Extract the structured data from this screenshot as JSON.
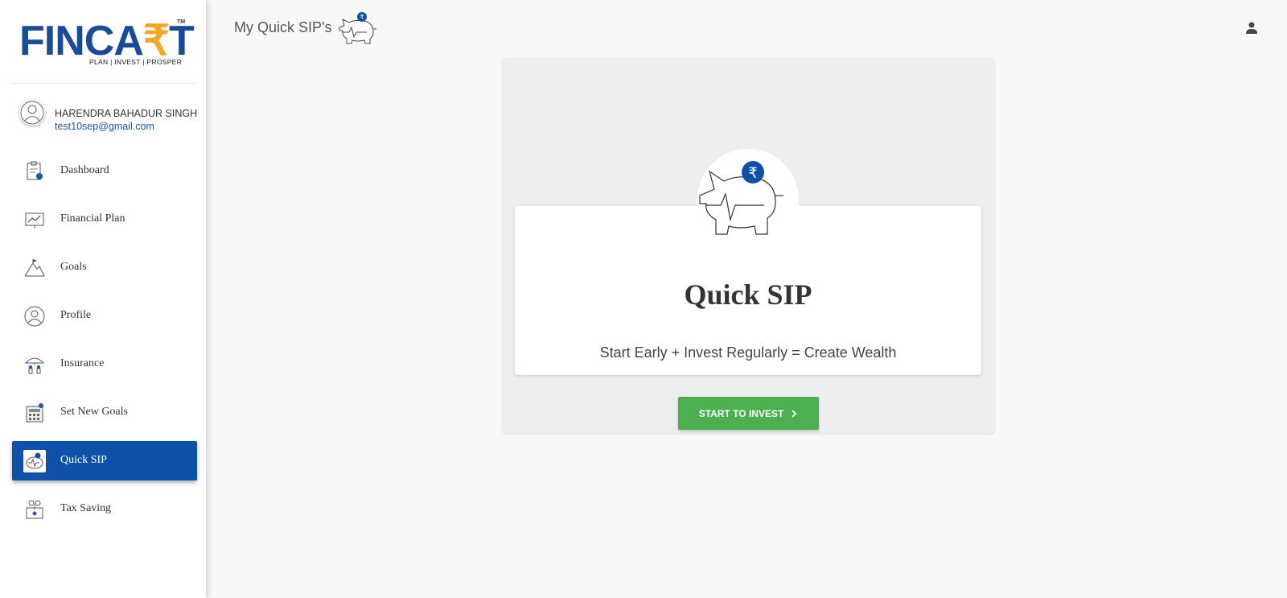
{
  "brand": {
    "logo_main_1": "FINCA",
    "logo_rupee": "₹",
    "logo_main_2": "T",
    "trademark": "TM",
    "tagline": "PLAN | INVEST | PROSPER",
    "primary_color": "#0d52a8",
    "accent_color": "#f5a623"
  },
  "user": {
    "name": "HARENDRA BAHADUR SINGH",
    "email": "test10sep@gmail.com",
    "avatar_icon": "user-circle-icon"
  },
  "nav": {
    "items": [
      {
        "label": "Dashboard",
        "icon": "clipboard-icon",
        "active": false
      },
      {
        "label": "Financial Plan",
        "icon": "chart-board-icon",
        "active": false
      },
      {
        "label": "Goals",
        "icon": "mountain-flag-icon",
        "active": false
      },
      {
        "label": "Profile",
        "icon": "profile-icon",
        "active": false
      },
      {
        "label": "Insurance",
        "icon": "umbrella-family-icon",
        "active": false
      },
      {
        "label": "Set New Goals",
        "icon": "calculator-icon",
        "active": false
      },
      {
        "label": "Quick SIP",
        "icon": "piggy-bank-icon",
        "active": true
      },
      {
        "label": "Tax Saving",
        "icon": "tax-saving-icon",
        "active": false
      }
    ]
  },
  "header": {
    "title": "My Quick SIP's",
    "icon": "piggy-bank-icon",
    "account_icon": "person-icon"
  },
  "card": {
    "title": "Quick SIP",
    "subtitle": "Start Early + Invest Regularly = Create Wealth",
    "icon": "piggy-bank-rupee-icon",
    "cta_label": "START TO INVEST",
    "cta_color": "#4caf50"
  }
}
